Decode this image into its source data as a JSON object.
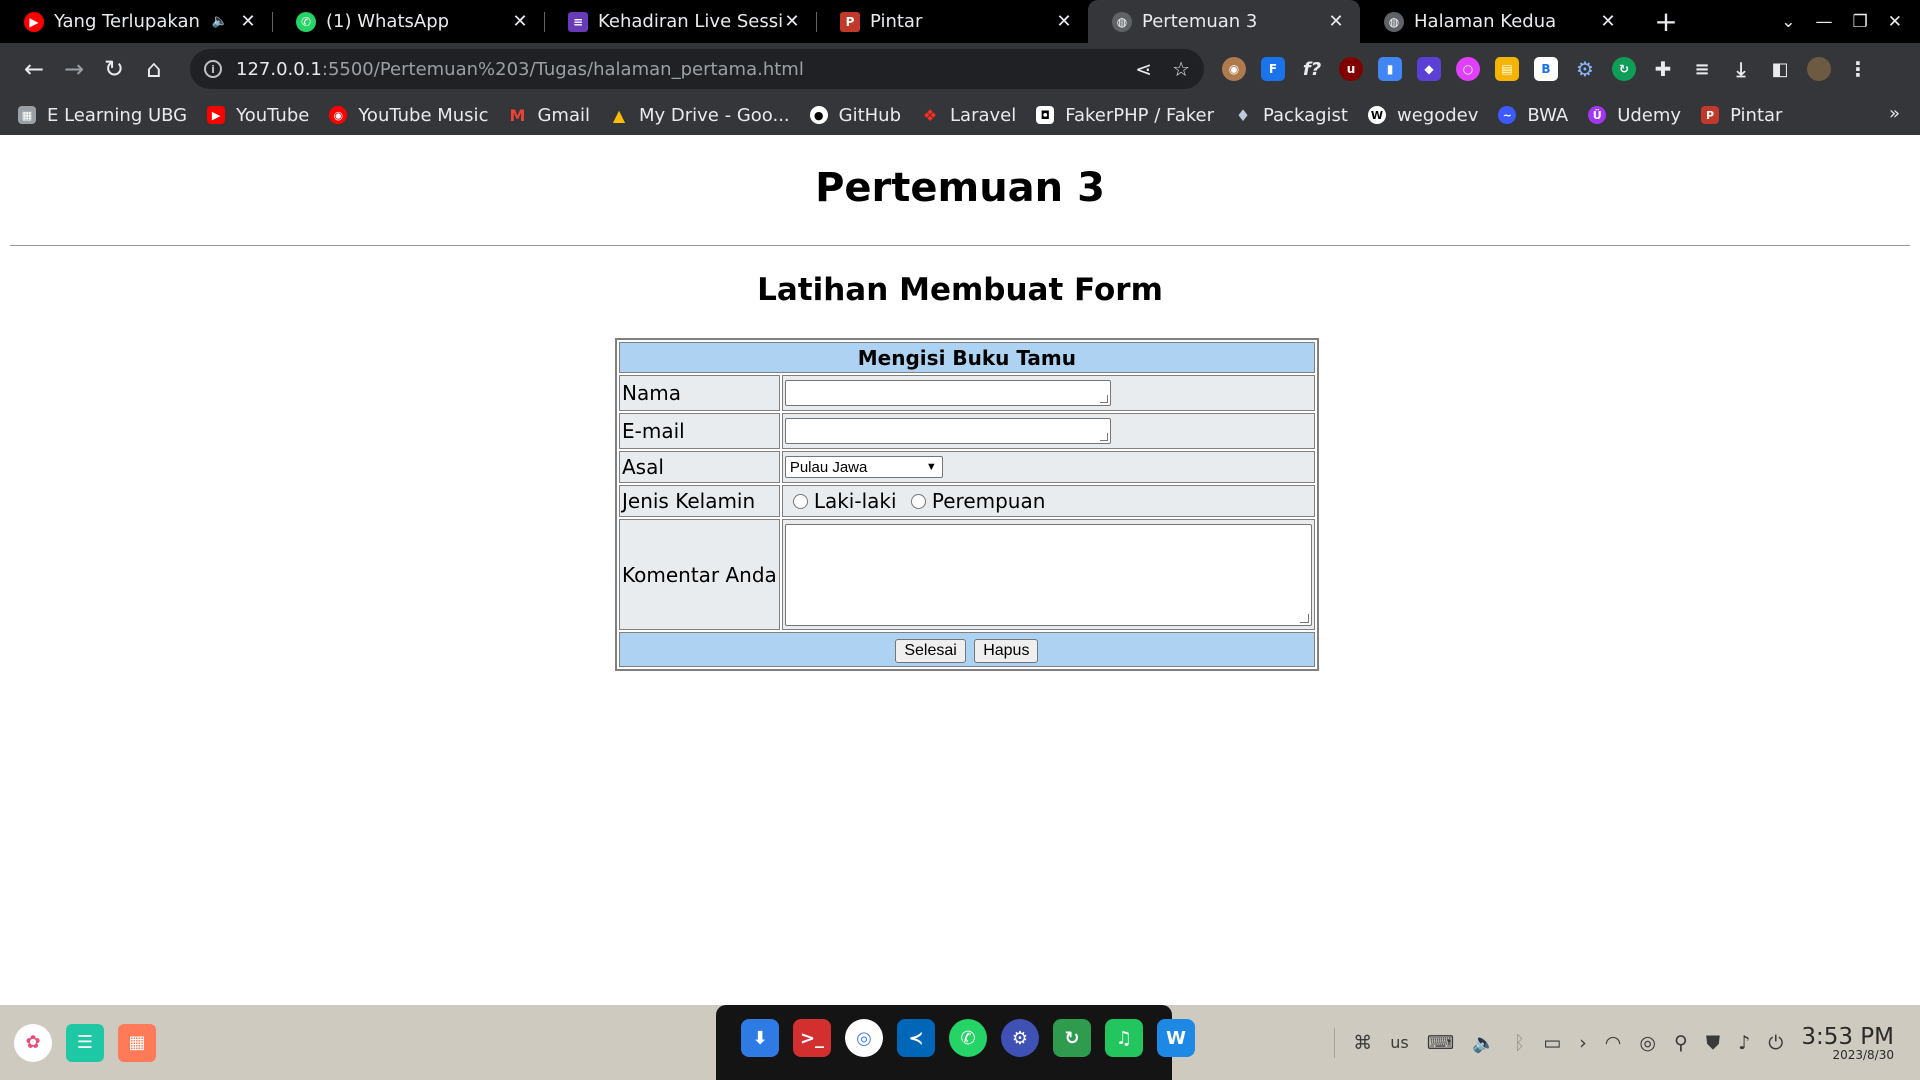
{
  "browser": {
    "tabs": [
      {
        "title": "Yang Terlupakan - Yo",
        "favicon": "youtube-icon",
        "color": "#ff0000",
        "audio": true
      },
      {
        "title": "(1) WhatsApp",
        "favicon": "whatsapp-icon",
        "color": "#25d366"
      },
      {
        "title": "Kehadiran Live Session",
        "favicon": "form-icon",
        "color": "#673ab7"
      },
      {
        "title": "Pintar",
        "favicon": "pintar-icon",
        "color": "#c0392b"
      },
      {
        "title": "Pertemuan 3",
        "favicon": "globe-icon",
        "active": true
      },
      {
        "title": "Halaman Kedua",
        "favicon": "globe-icon"
      }
    ],
    "new_tab": "+",
    "url": {
      "host": "127.0.0.1",
      "path": ":5500/Pertemuan%203/Tugas/halaman_pertama.html"
    },
    "bookmarks": [
      {
        "label": "E Learning UBG",
        "icon": "elearning-icon",
        "color": "#5f6368"
      },
      {
        "label": "YouTube",
        "icon": "youtube-icon",
        "color": "#ff0000"
      },
      {
        "label": "YouTube Music",
        "icon": "youtube-music-icon",
        "color": "#ff0000"
      },
      {
        "label": "Gmail",
        "icon": "gmail-icon",
        "color": "#ea4335"
      },
      {
        "label": "My Drive - Goo...",
        "icon": "drive-icon",
        "color": "#34a853"
      },
      {
        "label": "GitHub",
        "icon": "github-icon",
        "color": "#ffffff"
      },
      {
        "label": "Laravel",
        "icon": "laravel-icon",
        "color": "#ff2d20"
      },
      {
        "label": "FakerPHP / Faker",
        "icon": "faker-icon",
        "color": "#ffffff"
      },
      {
        "label": "Packagist",
        "icon": "packagist-icon",
        "color": "#bfc9d9"
      },
      {
        "label": "wegodev",
        "icon": "wegodev-icon",
        "color": "#ffffff"
      },
      {
        "label": "BWA",
        "icon": "bwa-icon",
        "color": "#3d5afe"
      },
      {
        "label": "Udemy",
        "icon": "udemy-icon",
        "color": "#a435f0"
      },
      {
        "label": "Pintar",
        "icon": "pintar-icon",
        "color": "#c0392b"
      }
    ]
  },
  "page": {
    "title": "Pertemuan 3",
    "subtitle": "Latihan Membuat Form",
    "form": {
      "header": "Mengisi Buku Tamu",
      "labels": {
        "nama": "Nama",
        "email": "E-mail",
        "asal": "Asal",
        "jenis_kelamin": "Jenis Kelamin",
        "komentar": "Komentar Anda"
      },
      "values": {
        "nama": "",
        "email": "",
        "komentar": ""
      },
      "asal_selected": "Pulau Jawa",
      "gender_options": [
        "Laki-laki",
        "Perempuan"
      ],
      "buttons": {
        "submit": "Selesai",
        "reset": "Hapus"
      }
    }
  },
  "taskbar": {
    "keyboard_layout": "us",
    "time": "3:53 PM",
    "date": "2023/8/30"
  }
}
